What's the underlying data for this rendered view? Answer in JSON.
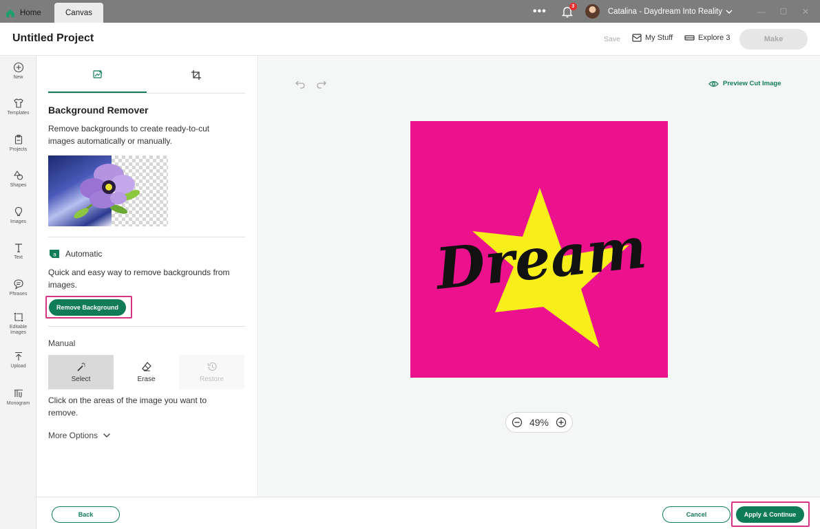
{
  "colors": {
    "brand": "#0f7b57",
    "highlight": "#d63384",
    "artwork_bg": "#ec118c",
    "star": "#f7ee1a"
  },
  "titlebar": {
    "home_tab": "Home",
    "canvas_tab": "Canvas",
    "more_dots": "•••",
    "notification_count": "3",
    "user_name": "Catalina - Daydream Into Reality"
  },
  "header": {
    "project_title": "Untitled Project",
    "save_label": "Save",
    "my_stuff_label": "My Stuff",
    "explore_label": "Explore 3",
    "make_label": "Make"
  },
  "rail": {
    "items": [
      {
        "label": "New",
        "icon": "plus-circle-icon"
      },
      {
        "label": "Templates",
        "icon": "shirt-icon"
      },
      {
        "label": "Projects",
        "icon": "clipboard-icon"
      },
      {
        "label": "Shapes",
        "icon": "shapes-icon"
      },
      {
        "label": "Images",
        "icon": "lightbulb-icon"
      },
      {
        "label": "Text",
        "icon": "text-icon"
      },
      {
        "label": "Phrases",
        "icon": "speech-bubble-icon"
      },
      {
        "label": "Editable Images",
        "icon": "editable-image-icon"
      },
      {
        "label": "Upload",
        "icon": "upload-icon"
      },
      {
        "label": "Monogram",
        "icon": "monogram-icon"
      }
    ]
  },
  "panel": {
    "title": "Background Remover",
    "description": "Remove backgrounds to create ready-to-cut images automatically or manually.",
    "automatic_label": "Automatic",
    "automatic_desc": "Quick and easy way to remove backgrounds from images.",
    "remove_button": "Remove Background",
    "manual_label": "Manual",
    "tools": {
      "select": "Select",
      "erase": "Erase",
      "restore": "Restore"
    },
    "manual_desc": "Click on the areas of the image you want to remove.",
    "more_options": "More Options"
  },
  "canvas": {
    "preview_label": "Preview Cut Image",
    "artwork_text": "Dream",
    "zoom": "49%"
  },
  "footer": {
    "back_label": "Back",
    "cancel_label": "Cancel",
    "apply_label": "Apply & Continue"
  }
}
